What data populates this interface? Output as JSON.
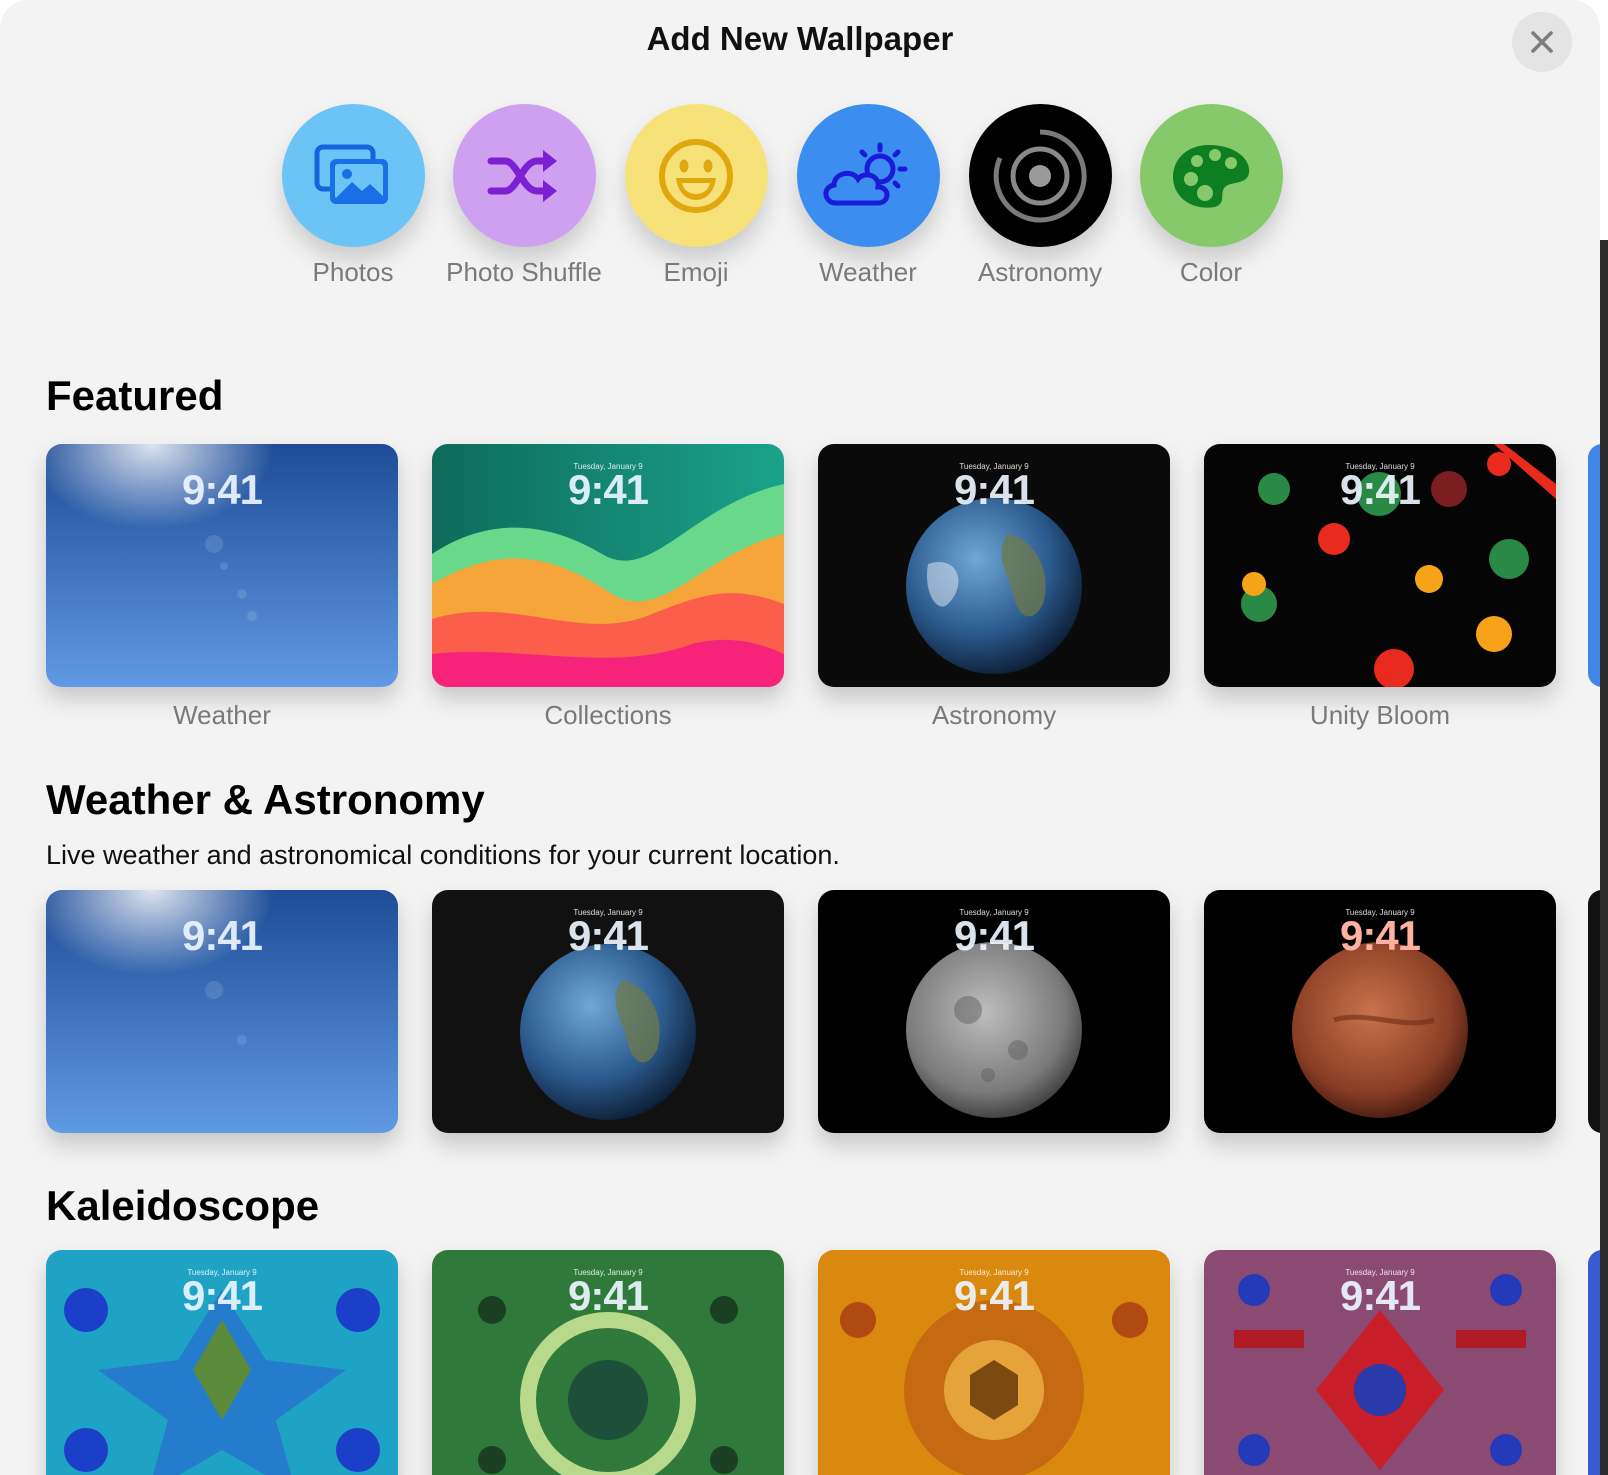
{
  "header": {
    "title": "Add New Wallpaper",
    "close_icon": "xmark-icon"
  },
  "wallpaper_types": [
    {
      "label": "Photos",
      "icon": "photos-icon",
      "color": "#6cc4f6"
    },
    {
      "label": "Photo Shuffle",
      "icon": "shuffle-icon",
      "color": "#cf9ff0"
    },
    {
      "label": "Emoji",
      "icon": "smiley-icon",
      "color": "#f7e27a"
    },
    {
      "label": "Weather",
      "icon": "cloud-sun-icon",
      "color": "#3b8ef0"
    },
    {
      "label": "Astronomy",
      "icon": "astronomy-icon",
      "color": "#000000"
    },
    {
      "label": "Color",
      "icon": "palette-icon",
      "color": "#86c96a"
    }
  ],
  "featured": {
    "title": "Featured",
    "cards": [
      {
        "time": "9:41",
        "date": "",
        "label": "Weather"
      },
      {
        "time": "9:41",
        "date": "Tuesday, January 9",
        "label": "Collections"
      },
      {
        "time": "9:41",
        "date": "Tuesday, January 9",
        "label": "Astronomy"
      },
      {
        "time": "9:41",
        "date": "Tuesday, January 9",
        "label": "Unity Bloom"
      }
    ]
  },
  "weather_astronomy": {
    "title": "Weather & Astronomy",
    "subtitle": "Live weather and astronomical conditions for your current location.",
    "cards": [
      {
        "time": "9:41",
        "date": ""
      },
      {
        "time": "9:41",
        "date": "Tuesday, January 9"
      },
      {
        "time": "9:41",
        "date": "Tuesday, January 9"
      },
      {
        "time": "9:41",
        "date": "Tuesday, January 9"
      }
    ]
  },
  "kaleidoscope": {
    "title": "Kaleidoscope",
    "cards": [
      {
        "time": "9:41",
        "date": "Tuesday, January 9"
      },
      {
        "time": "9:41",
        "date": "Tuesday, January 9"
      },
      {
        "time": "9:41",
        "date": "Tuesday, January 9"
      },
      {
        "time": "9:41",
        "date": "Tuesday, January 9"
      }
    ]
  }
}
